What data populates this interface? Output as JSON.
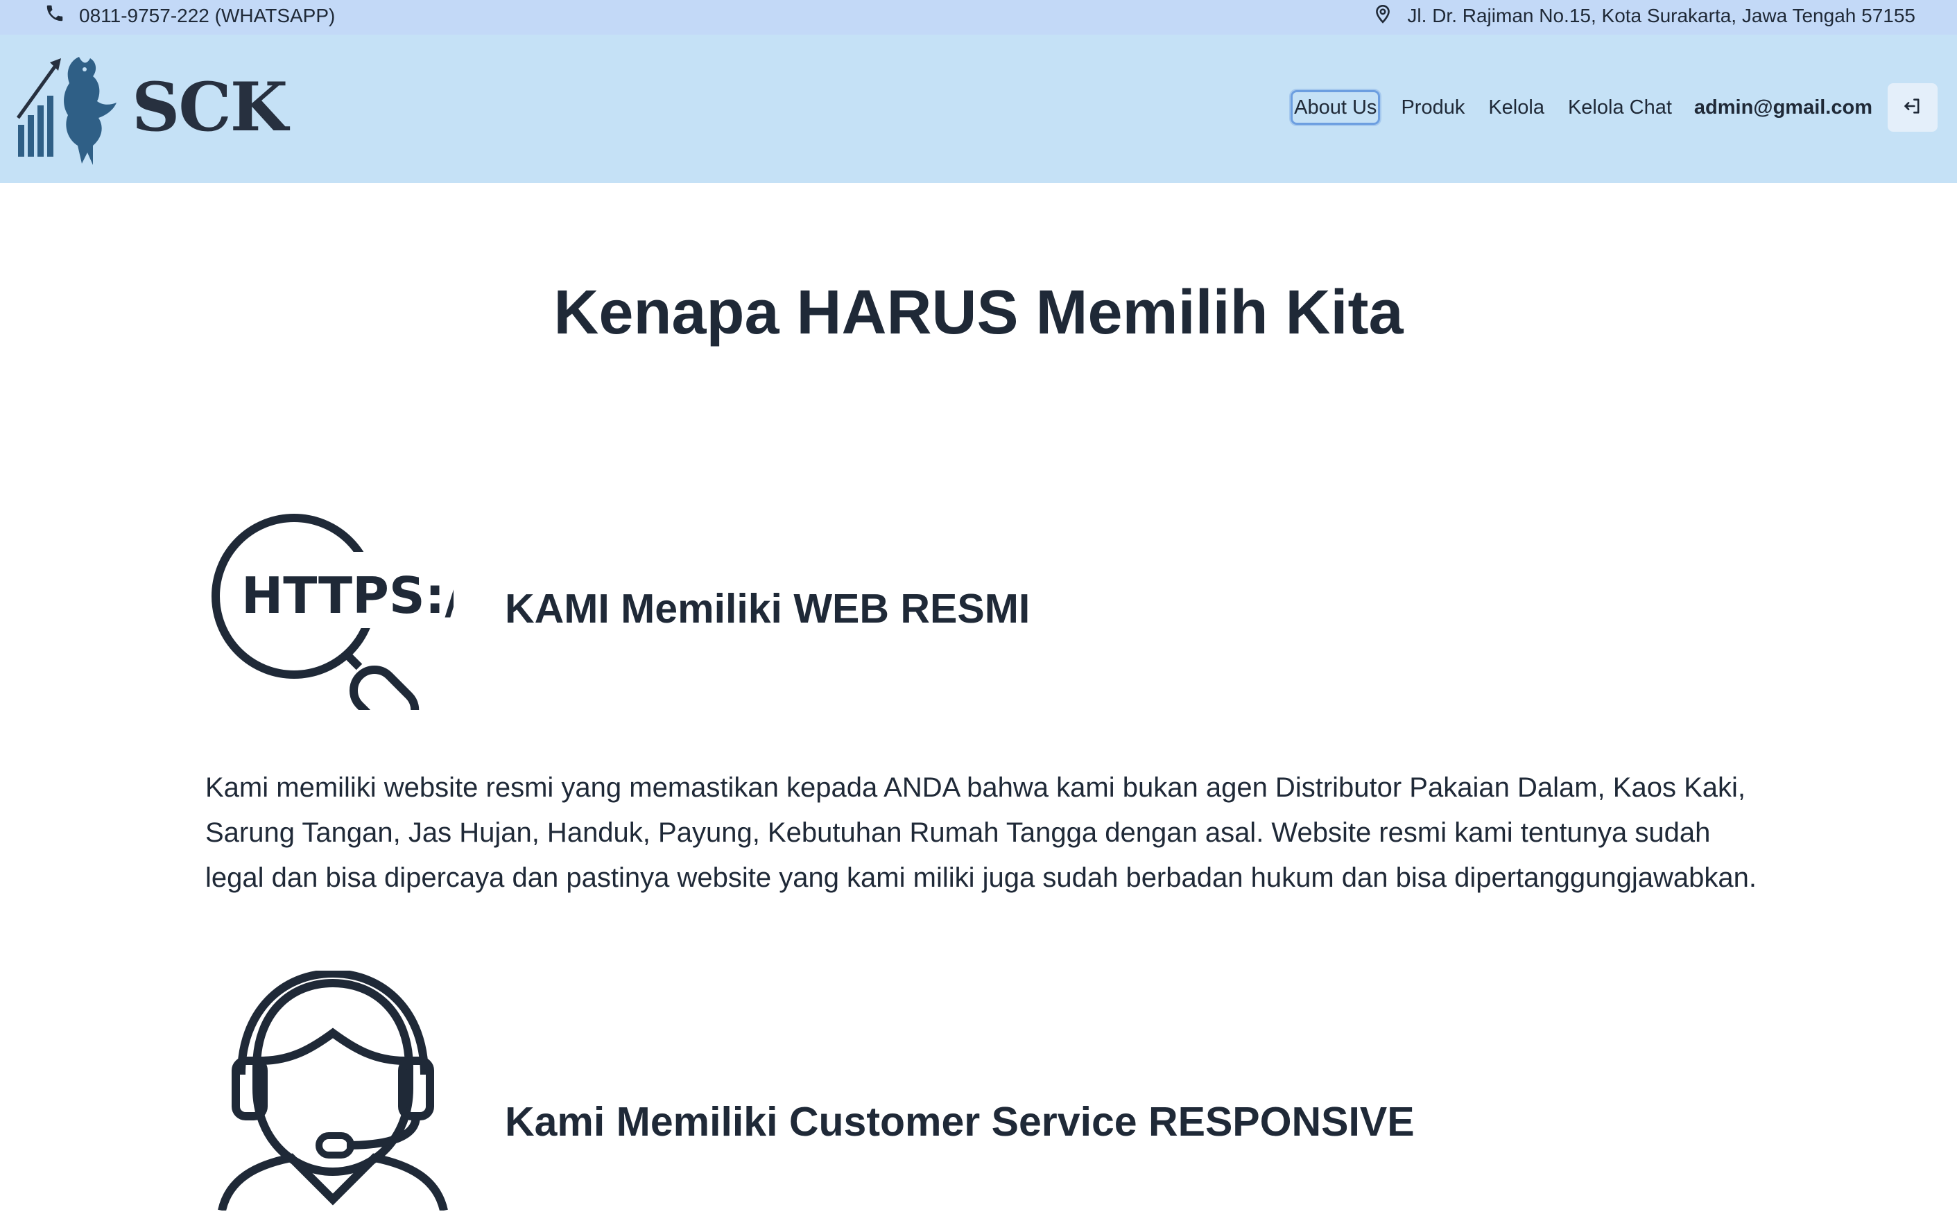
{
  "topbar": {
    "phone_icon": "phone-icon",
    "phone": "0811-9757-222 (WHATSAPP)",
    "location_icon": "map-pin-icon",
    "address": "Jl. Dr. Rajiman No.15, Kota Surakarta, Jawa Tengah 57155"
  },
  "brand": {
    "logo_icon": "dragon-chart-logo",
    "name": "SCK"
  },
  "nav": {
    "items": [
      {
        "label": "About Us",
        "active": true
      },
      {
        "label": "Produk"
      },
      {
        "label": "Kelola"
      },
      {
        "label": "Kelola Chat"
      }
    ],
    "user_email": "admin@gmail.com",
    "logout_icon": "logout-icon"
  },
  "colors": {
    "topbar_bg": "#c3d9f7",
    "navbar_bg": "#c5e1f6",
    "text": "#1f2937",
    "active_outline": "#6c9ee0"
  },
  "main": {
    "title": "Kenapa HARUS Memilih Kita",
    "features": [
      {
        "icon": "https-search-icon",
        "title": "KAMI Memiliki WEB RESMI",
        "description": "Kami memiliki website resmi yang memastikan kepada ANDA bahwa kami bukan agen Distributor Pakaian Dalam, Kaos Kaki, Sarung Tangan, Jas Hujan, Handuk, Payung, Kebutuhan Rumah Tangga dengan asal. Website resmi kami tentunya sudah legal dan bisa dipercaya dan pastinya website yang kami miliki juga sudah berbadan hukum dan bisa dipertanggungjawabkan."
      },
      {
        "icon": "customer-service-headset-icon",
        "title": "Kami Memiliki Customer Service RESPONSIVE"
      }
    ]
  }
}
